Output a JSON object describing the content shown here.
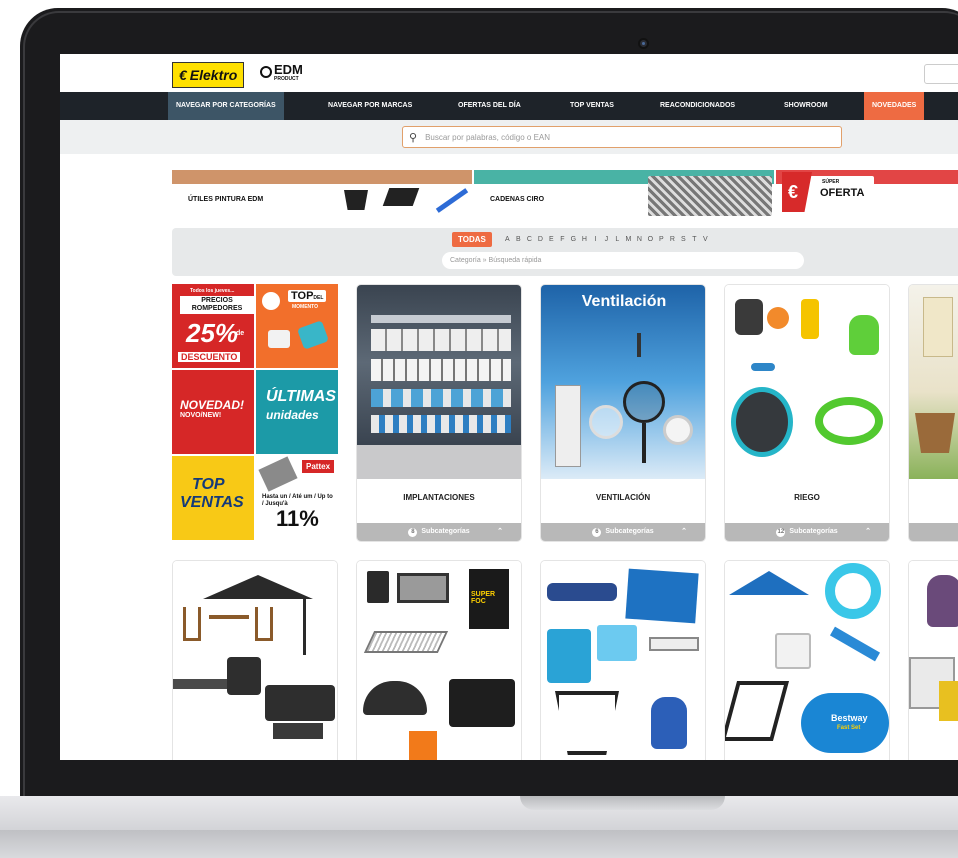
{
  "brand": {
    "elektro": "Elektro",
    "edm": "EDM",
    "edm_sub": "PRODUCT"
  },
  "nav": {
    "items": [
      "NAVEGAR POR CATEGORÍAS",
      "NAVEGAR POR MARCAS",
      "OFERTAS DEL DÍA",
      "TOP VENTAS",
      "REACONDICIONADOS",
      "SHOWROOM",
      "NOVEDADES"
    ],
    "active_index": 0
  },
  "search": {
    "placeholder": "Buscar por palabras, código o EAN"
  },
  "promos": {
    "utiles": "ÚTILES PINTURA EDM",
    "cadenas": "CADENAS CIRO",
    "super": "SÚPER",
    "oferta": "OFERTA"
  },
  "filter": {
    "todas": "TODAS",
    "letters": [
      "A",
      "B",
      "C",
      "D",
      "E",
      "F",
      "G",
      "H",
      "I",
      "J",
      "L",
      "M",
      "N",
      "O",
      "P",
      "R",
      "S",
      "T",
      "V"
    ],
    "quick_search_placeholder": "Categoría » Búsqueda rápida"
  },
  "promo_grid": {
    "p1_small": "Todos los jueves...",
    "p1_precios": "PRECIOS ROMPEDORES",
    "p1_pct": "25%",
    "p1_de": "de",
    "p1_desc": "DESCUENTO",
    "p2_top": "TOP",
    "p2_del": "DEL",
    "p2_momento": "MOMENTO",
    "p3_novedad": "NOVEDAD!",
    "p3_novo": "NOVO/NEW!",
    "p4_ultimas": "ÚLTIMAS",
    "p4_unidades": "unidades",
    "p5_top": "TOP",
    "p5_ventas": "VENTAS",
    "p6_brand": "Pattex",
    "p6_hasta": "Hasta un / Até um / Up to / Jusqu'à",
    "p6_pct": "11%"
  },
  "categories": [
    {
      "title": "IMPLANTACIONES",
      "count": "8",
      "sub_label": "Subcategorías"
    },
    {
      "title": "VENTILACIÓN",
      "image_title": "Ventilación",
      "count": "6",
      "sub_label": "Subcategorías"
    },
    {
      "title": "RIEGO",
      "count": "12",
      "sub_label": "Subcategorías"
    }
  ],
  "product_labels": {
    "bestway": "Bestway",
    "fast_set": "Fast Set",
    "super_fog": "SUPER FOC"
  }
}
